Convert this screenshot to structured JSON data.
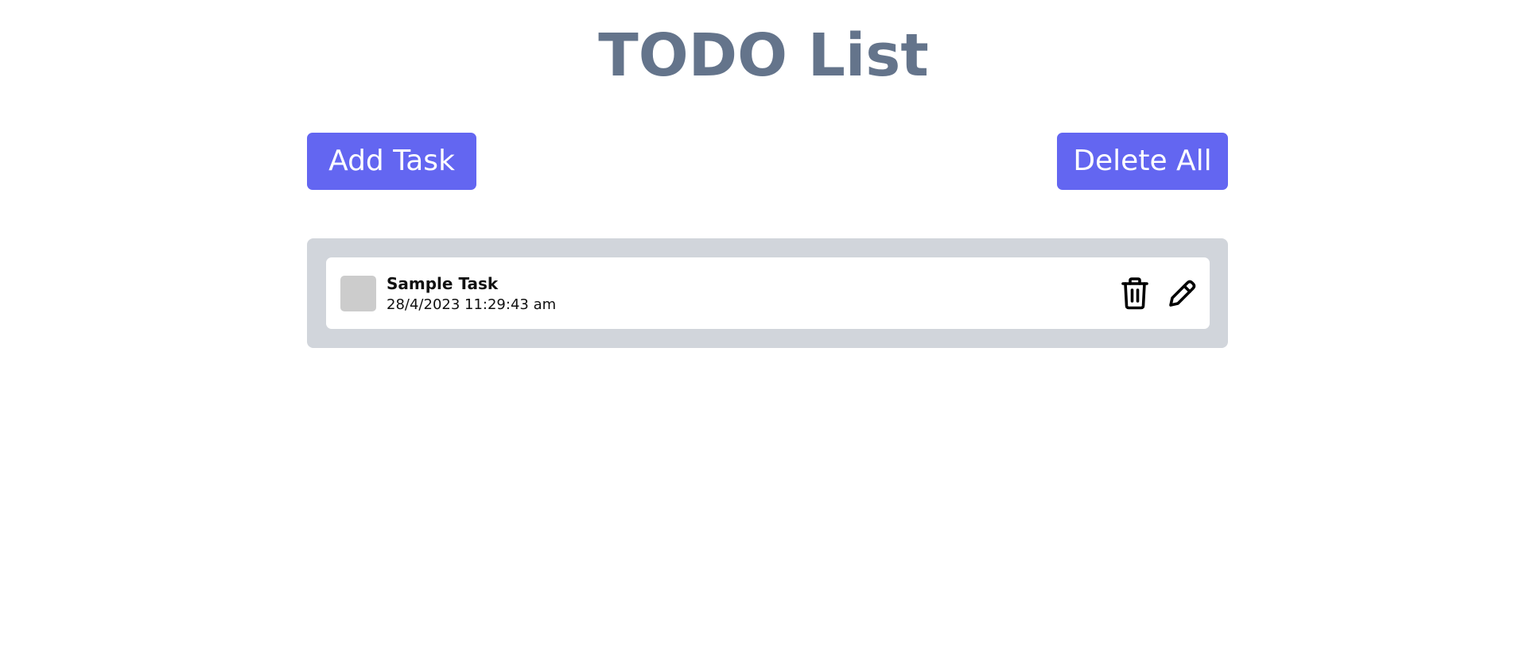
{
  "header": {
    "title": "TODO List"
  },
  "toolbar": {
    "add_label": "Add Task",
    "delete_all_label": "Delete All"
  },
  "tasks": [
    {
      "title": "Sample Task",
      "timestamp": "28/4/2023 11:29:43 am",
      "completed": false,
      "icons": [
        "trash-icon",
        "edit-pencil-icon"
      ]
    }
  ],
  "colors": {
    "title": "#64748b",
    "button_bg": "#6366f1",
    "button_text": "#ffffff",
    "panel_bg": "#d1d5db",
    "card_bg": "#ffffff",
    "checkbox_bg": "#cccccc"
  }
}
